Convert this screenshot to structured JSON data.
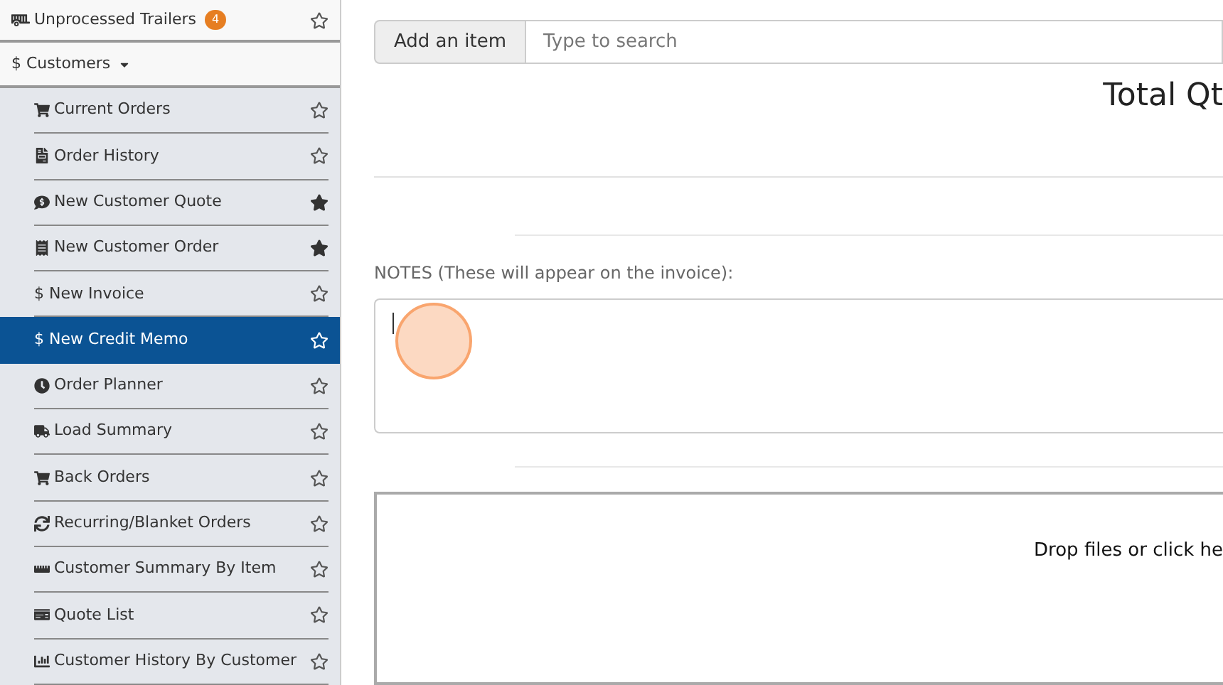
{
  "sidebar": {
    "top_item": {
      "label": "Unprocessed Trailers",
      "badge": "4",
      "starred": false
    },
    "section": {
      "label": "$ Customers",
      "expanded": true
    },
    "items": [
      {
        "label": "Current Orders",
        "starred": false,
        "selected": false
      },
      {
        "label": "Order History",
        "starred": false,
        "selected": false
      },
      {
        "label": "New Customer Quote",
        "starred": true,
        "selected": false
      },
      {
        "label": "New Customer Order",
        "starred": true,
        "selected": false
      },
      {
        "label": "$ New Invoice",
        "starred": false,
        "selected": false
      },
      {
        "label": "$ New Credit Memo",
        "starred": false,
        "selected": true
      },
      {
        "label": "Order Planner",
        "starred": false,
        "selected": false
      },
      {
        "label": "Load Summary",
        "starred": false,
        "selected": false
      },
      {
        "label": "Back Orders",
        "starred": false,
        "selected": false
      },
      {
        "label": "Recurring/Blanket Orders",
        "starred": false,
        "selected": false
      },
      {
        "label": "Customer Summary By Item",
        "starred": false,
        "selected": false
      },
      {
        "label": "Quote List",
        "starred": false,
        "selected": false
      },
      {
        "label": "Customer History By Customer",
        "starred": false,
        "selected": false
      }
    ]
  },
  "main": {
    "add_item_button": "Add an item",
    "search": {
      "placeholder": "Type to search"
    },
    "total_label": "Total Qt",
    "notes": {
      "label": "NOTES (These will appear on the invoice):"
    },
    "dropzone": {
      "text": "Drop files or click he"
    }
  }
}
